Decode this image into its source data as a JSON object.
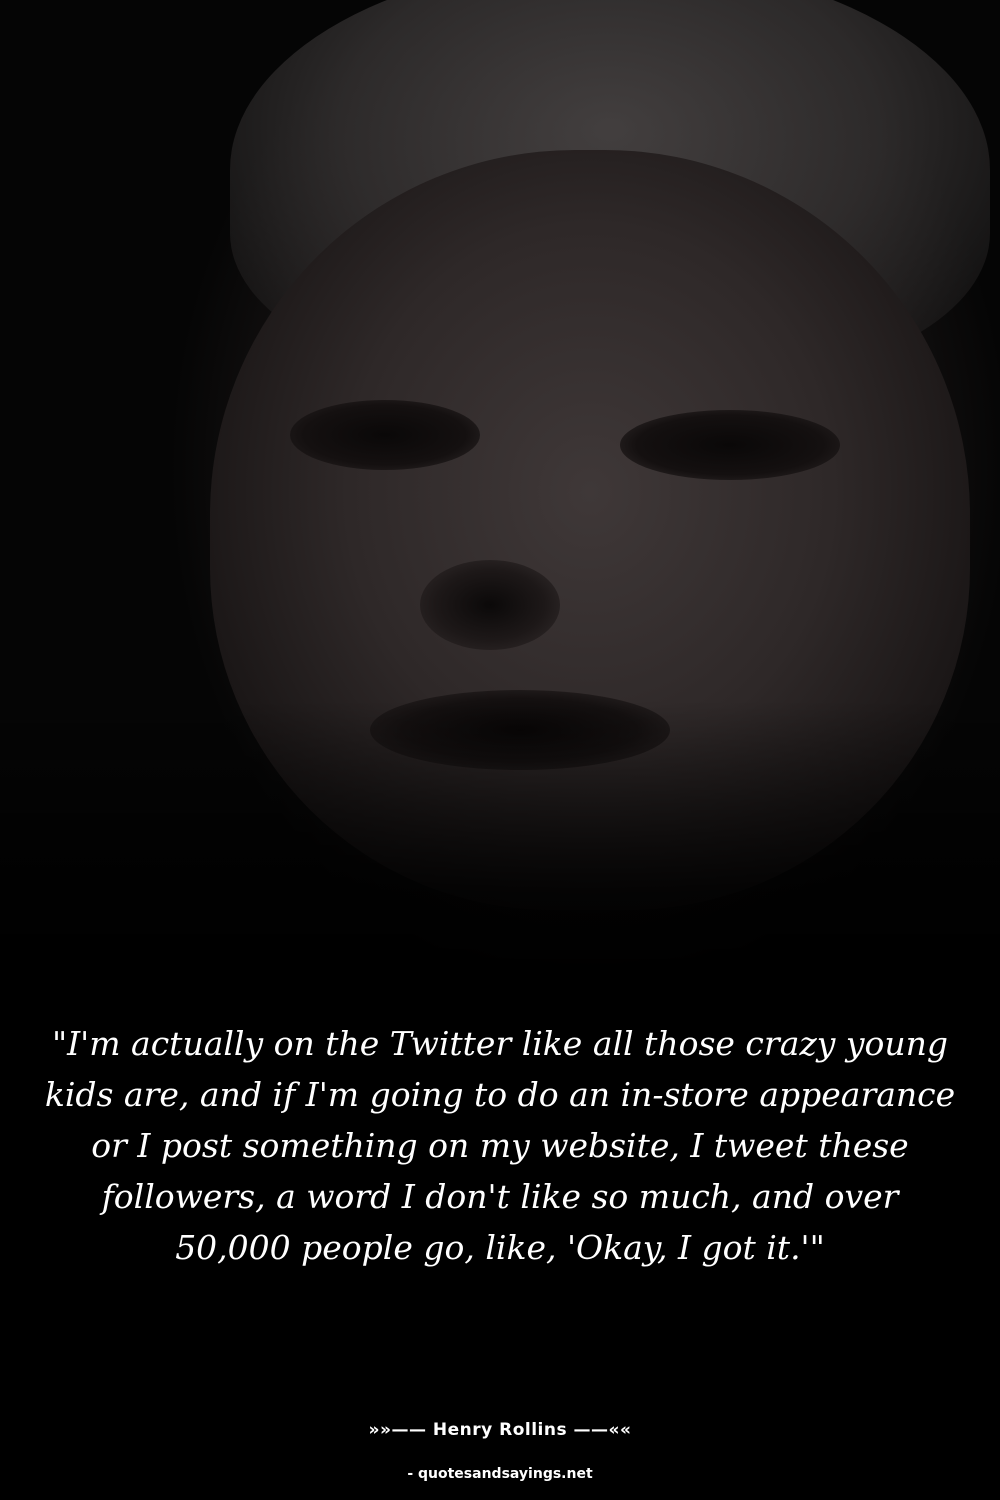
{
  "quote": {
    "text": "\"I'm actually on the Twitter like all those crazy young kids are, and if I'm going to do an in-store appearance or I post something on my website, I tweet these followers, a word I don't like so much, and over 50,000 people go, like, 'Okay, I got it.'\""
  },
  "author": {
    "label": "»»—— Henry Rollins ——««"
  },
  "source": {
    "label": "- quotesandsayings.net"
  },
  "colors": {
    "background": "#000000",
    "text": "#ffffff"
  }
}
